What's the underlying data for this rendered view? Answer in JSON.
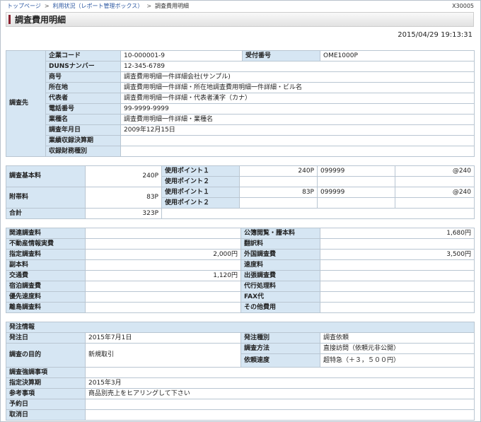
{
  "breadcrumb": {
    "items": [
      "トップページ",
      "利用状況（レポート管理ボックス）"
    ],
    "current": "調査費用明細"
  },
  "screen_code": "X30005",
  "page_title": "調査費用明細",
  "timestamp": "2015/04/29 19:13:31",
  "subject": {
    "section_label": "調査先",
    "company_code_label": "企業コード",
    "company_code": "10-000001-9",
    "receipt_no_label": "受付番号",
    "receipt_no": "OME1000P",
    "duns_label": "DUNSナンバー",
    "duns": "12-345-6789",
    "name_label": "商号",
    "name": "調査費用明細一件詳細会社(サンプル)",
    "address_label": "所在地",
    "address": "調査費用明細一件詳細・所在地調査費用明細一件詳細・ビル名",
    "rep_label": "代表者",
    "rep": "調査費用明細一件詳細・代表者漢字（カナ）",
    "phone_label": "電話番号",
    "phone": "99-9999-9999",
    "industry_label": "業種名",
    "industry": "調査費用明細一件詳細・業種名",
    "survey_date_label": "調査年月日",
    "survey_date": "2009年12月15日",
    "settlement_label": "業績収録決算期",
    "settlement": "",
    "fin_type_label": "収録財務種別",
    "fin_type": ""
  },
  "fees": {
    "basic_label": "調査基本料",
    "basic": "240P",
    "basic_points": [
      {
        "label": "使用ポイント１",
        "value": "240P",
        "code": "099999",
        "rate": "@240"
      },
      {
        "label": "使用ポイント２",
        "value": "",
        "code": "",
        "rate": ""
      }
    ],
    "extra_label": "附帯料",
    "extra": "83P",
    "extra_points": [
      {
        "label": "使用ポイント１",
        "value": "83P",
        "code": "099999",
        "rate": "@240"
      },
      {
        "label": "使用ポイント２",
        "value": "",
        "code": "",
        "rate": ""
      }
    ],
    "total_label": "合計",
    "total": "323P"
  },
  "charges": {
    "rows": [
      {
        "left_label": "関連調査料",
        "left_value": "",
        "right_label": "公簿閲覧・謄本料",
        "right_value": "1,680円"
      },
      {
        "left_label": "不動産情報実費",
        "left_value": "",
        "right_label": "翻訳料",
        "right_value": ""
      },
      {
        "left_label": "指定調査料",
        "left_value": "2,000円",
        "right_label": "外国調査費",
        "right_value": "3,500円"
      },
      {
        "left_label": "副本料",
        "left_value": "",
        "right_label": "速度料",
        "right_value": ""
      },
      {
        "left_label": "交通費",
        "left_value": "1,120円",
        "right_label": "出張調査費",
        "right_value": ""
      },
      {
        "left_label": "宿泊調査費",
        "left_value": "",
        "right_label": "代行処理料",
        "right_value": ""
      },
      {
        "left_label": "優先速度料",
        "left_value": "",
        "right_label": "FAX代",
        "right_value": ""
      },
      {
        "left_label": "離島調査料",
        "left_value": "",
        "right_label": "その他費用",
        "right_value": ""
      }
    ]
  },
  "order": {
    "section_label": "発注情報",
    "order_date_label": "発注日",
    "order_date": "2015年7月1日",
    "order_type_label": "発注種別",
    "order_type": "調査依頼",
    "purpose_label": "調査の目的",
    "purpose": "新規取引",
    "method_label": "調査方法",
    "method": "直接訪問（依頼元非公開）",
    "speed_label": "依頼速度",
    "speed": "超特急（＋３，５００円）",
    "emphasis_label": "調査強調事項",
    "emphasis": "",
    "settlement_label": "指定決算期",
    "settlement": "2015年3月",
    "notes_label": "参考事項",
    "notes": "商品別売上をヒアリングして下さい",
    "reserve_label": "予約日",
    "reserve": "",
    "cancel_label": "取消日",
    "cancel": ""
  }
}
